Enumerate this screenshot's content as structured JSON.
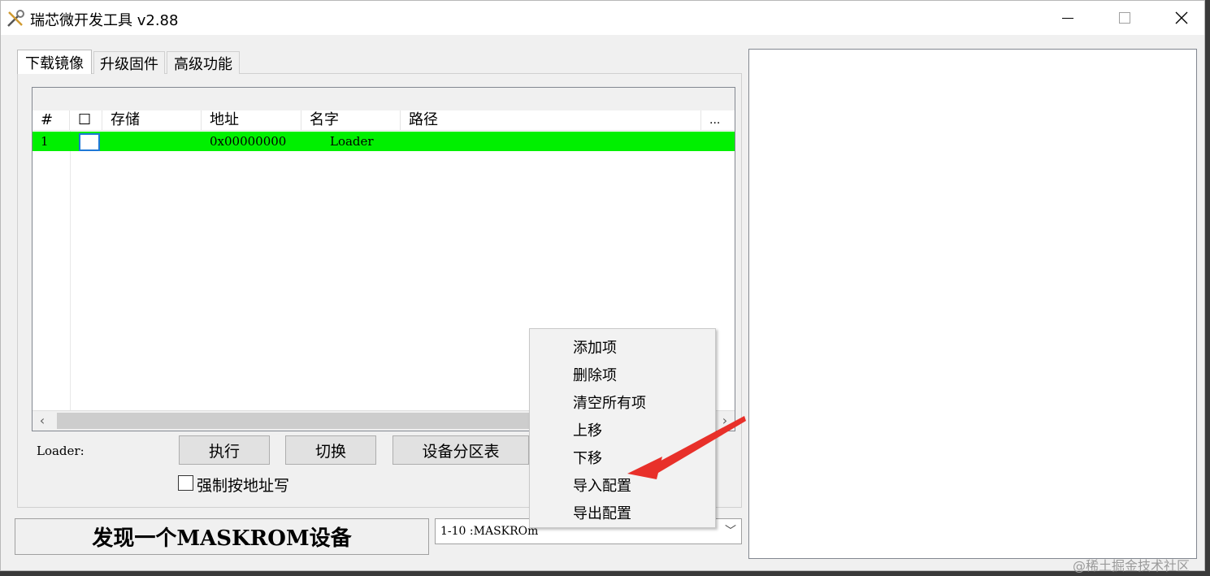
{
  "window": {
    "title": "瑞芯微开发工具 v2.88",
    "app_icon": "tools-icon"
  },
  "tabs": [
    {
      "label": "下载镜像",
      "active": true
    },
    {
      "label": "升级固件",
      "active": false
    },
    {
      "label": "高级功能",
      "active": false
    }
  ],
  "table": {
    "columns": [
      "#",
      "",
      "存储",
      "地址",
      "名字",
      "路径",
      "..."
    ],
    "header_checkbox": "☐",
    "rows": [
      {
        "index": "1",
        "checked": false,
        "storage": "",
        "address": "0x00000000",
        "name": "Loader",
        "path": "",
        "highlight_color": "#00f000"
      }
    ]
  },
  "buttons": {
    "execute": "执行",
    "switch": "切换",
    "partition_table": "设备分区表"
  },
  "loader_label": "Loader:",
  "force_write": {
    "label": "强制按地址写",
    "checked": false
  },
  "status": {
    "text": "发现一个MASKROM设备"
  },
  "device_select": {
    "value": "1-10 :MASKROm"
  },
  "context_menu": {
    "items": [
      "添加项",
      "删除项",
      "清空所有项",
      "上移",
      "下移",
      "导入配置",
      "导出配置"
    ]
  },
  "watermark": "@稀土掘金技术社区",
  "colors": {
    "row_highlight": "#00f000",
    "arrow": "#e8302a",
    "selection_blue": "#1e78d7"
  }
}
